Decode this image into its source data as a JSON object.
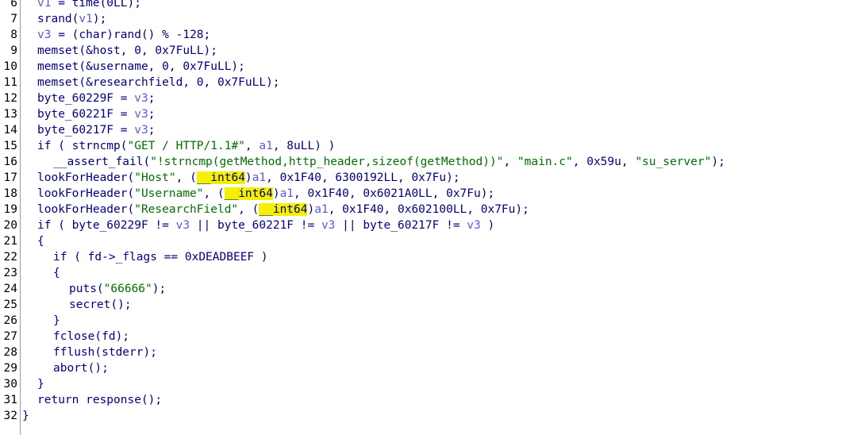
{
  "colors": {
    "keyword": "#000080",
    "variable": "#5a5ad8",
    "string": "#007000",
    "highlight": "#f5f000",
    "line_number": "#000000",
    "background": "#ffffff"
  },
  "lines": [
    {
      "num": "6",
      "indent": 1,
      "tokens": [
        {
          "t": "v1",
          "k": "var"
        },
        {
          "t": " = time(0LL);",
          "k": "kw"
        }
      ]
    },
    {
      "num": "7",
      "indent": 1,
      "tokens": [
        {
          "t": "srand(",
          "k": "kw"
        },
        {
          "t": "v1",
          "k": "var"
        },
        {
          "t": ");",
          "k": "kw"
        }
      ]
    },
    {
      "num": "8",
      "indent": 1,
      "tokens": [
        {
          "t": "v3",
          "k": "var"
        },
        {
          "t": " = (char)rand() % -128;",
          "k": "kw"
        }
      ]
    },
    {
      "num": "9",
      "indent": 1,
      "tokens": [
        {
          "t": "memset(&host, 0, 0x7FuLL);",
          "k": "kw"
        }
      ]
    },
    {
      "num": "10",
      "indent": 1,
      "tokens": [
        {
          "t": "memset(&username, 0, 0x7FuLL);",
          "k": "kw"
        }
      ]
    },
    {
      "num": "11",
      "indent": 1,
      "tokens": [
        {
          "t": "memset(&researchfield, 0, 0x7FuLL);",
          "k": "kw"
        }
      ]
    },
    {
      "num": "12",
      "indent": 1,
      "tokens": [
        {
          "t": "byte_60229F = ",
          "k": "kw"
        },
        {
          "t": "v3",
          "k": "var"
        },
        {
          "t": ";",
          "k": "kw"
        }
      ]
    },
    {
      "num": "13",
      "indent": 1,
      "tokens": [
        {
          "t": "byte_60221F = ",
          "k": "kw"
        },
        {
          "t": "v3",
          "k": "var"
        },
        {
          "t": ";",
          "k": "kw"
        }
      ]
    },
    {
      "num": "14",
      "indent": 1,
      "tokens": [
        {
          "t": "byte_60217F = ",
          "k": "kw"
        },
        {
          "t": "v3",
          "k": "var"
        },
        {
          "t": ";",
          "k": "kw"
        }
      ]
    },
    {
      "num": "15",
      "indent": 1,
      "tokens": [
        {
          "t": "if ( strncmp(",
          "k": "kw"
        },
        {
          "t": "\"GET / HTTP/1.1#\"",
          "k": "str"
        },
        {
          "t": ", ",
          "k": "kw"
        },
        {
          "t": "a1",
          "k": "var"
        },
        {
          "t": ", 8uLL) )",
          "k": "kw"
        }
      ]
    },
    {
      "num": "16",
      "indent": 2,
      "tokens": [
        {
          "t": "__assert_fail(",
          "k": "kw"
        },
        {
          "t": "\"!strncmp(getMethod,http_header,sizeof(getMethod))\"",
          "k": "str"
        },
        {
          "t": ", ",
          "k": "kw"
        },
        {
          "t": "\"main.c\"",
          "k": "str"
        },
        {
          "t": ", 0x59u, ",
          "k": "kw"
        },
        {
          "t": "\"su_server\"",
          "k": "str"
        },
        {
          "t": ");",
          "k": "kw"
        }
      ]
    },
    {
      "num": "17",
      "indent": 1,
      "tokens": [
        {
          "t": "lookForHeader(",
          "k": "kw"
        },
        {
          "t": "\"Host\"",
          "k": "str"
        },
        {
          "t": ", (",
          "k": "kw"
        },
        {
          "t": "__int64",
          "k": "hl"
        },
        {
          "t": ")",
          "k": "kw"
        },
        {
          "t": "a1",
          "k": "var"
        },
        {
          "t": ", 0x1F40, 6300192LL, 0x7Fu);",
          "k": "kw"
        }
      ]
    },
    {
      "num": "18",
      "indent": 1,
      "tokens": [
        {
          "t": "lookForHeader(",
          "k": "kw"
        },
        {
          "t": "\"Username\"",
          "k": "str"
        },
        {
          "t": ", (",
          "k": "kw"
        },
        {
          "t": "__int64",
          "k": "hl"
        },
        {
          "t": ")",
          "k": "kw"
        },
        {
          "t": "a1",
          "k": "var"
        },
        {
          "t": ", 0x1F40, 0x6021A0LL, 0x7Fu);",
          "k": "kw"
        }
      ]
    },
    {
      "num": "19",
      "indent": 1,
      "tokens": [
        {
          "t": "lookForHeader(",
          "k": "kw"
        },
        {
          "t": "\"ResearchField\"",
          "k": "str"
        },
        {
          "t": ", (",
          "k": "kw"
        },
        {
          "t": "__int64",
          "k": "hl"
        },
        {
          "t": ")",
          "k": "kw"
        },
        {
          "t": "a1",
          "k": "var"
        },
        {
          "t": ", 0x1F40, 0x602100LL, 0x7Fu);",
          "k": "kw"
        }
      ]
    },
    {
      "num": "20",
      "indent": 1,
      "tokens": [
        {
          "t": "if ( byte_60229F != ",
          "k": "kw"
        },
        {
          "t": "v3",
          "k": "var"
        },
        {
          "t": " || byte_60221F != ",
          "k": "kw"
        },
        {
          "t": "v3",
          "k": "var"
        },
        {
          "t": " || byte_60217F != ",
          "k": "kw"
        },
        {
          "t": "v3",
          "k": "var"
        },
        {
          "t": " )",
          "k": "kw"
        }
      ]
    },
    {
      "num": "21",
      "indent": 1,
      "tokens": [
        {
          "t": "{",
          "k": "kw"
        }
      ]
    },
    {
      "num": "22",
      "indent": 2,
      "tokens": [
        {
          "t": "if ( fd->_flags == 0xDEADBEEF )",
          "k": "kw"
        }
      ]
    },
    {
      "num": "23",
      "indent": 2,
      "tokens": [
        {
          "t": "{",
          "k": "kw"
        }
      ]
    },
    {
      "num": "24",
      "indent": 3,
      "tokens": [
        {
          "t": "puts(",
          "k": "kw"
        },
        {
          "t": "\"66666\"",
          "k": "str"
        },
        {
          "t": ");",
          "k": "kw"
        }
      ]
    },
    {
      "num": "25",
      "indent": 3,
      "tokens": [
        {
          "t": "secret();",
          "k": "kw"
        }
      ]
    },
    {
      "num": "26",
      "indent": 2,
      "tokens": [
        {
          "t": "}",
          "k": "kw"
        }
      ]
    },
    {
      "num": "27",
      "indent": 2,
      "tokens": [
        {
          "t": "fclose(fd);",
          "k": "kw"
        }
      ]
    },
    {
      "num": "28",
      "indent": 2,
      "tokens": [
        {
          "t": "fflush(stderr);",
          "k": "kw"
        }
      ]
    },
    {
      "num": "29",
      "indent": 2,
      "tokens": [
        {
          "t": "abort();",
          "k": "kw"
        }
      ]
    },
    {
      "num": "30",
      "indent": 1,
      "tokens": [
        {
          "t": "}",
          "k": "kw"
        }
      ]
    },
    {
      "num": "31",
      "indent": 1,
      "tokens": [
        {
          "t": "return response();",
          "k": "kw"
        }
      ]
    },
    {
      "num": "32",
      "indent": 0,
      "tokens": [
        {
          "t": "}",
          "k": "kw"
        }
      ]
    }
  ]
}
